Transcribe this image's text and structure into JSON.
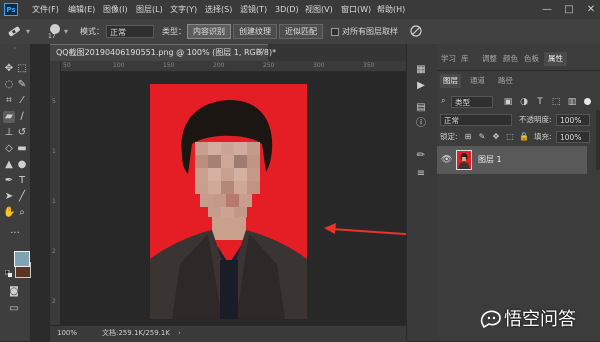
{
  "app": {
    "logo": "Ps"
  },
  "menu": [
    "文件(F)",
    "编辑(E)",
    "图像(I)",
    "图层(L)",
    "文字(Y)",
    "选择(S)",
    "滤镜(T)",
    "3D(D)",
    "视图(V)",
    "窗口(W)",
    "帮助(H)"
  ],
  "window_controls": {
    "minimize": "—",
    "maximize": "□",
    "close": "✕"
  },
  "options": {
    "brush_size": "17",
    "mode_label": "模式：",
    "mode_value": "正常",
    "type_label": "类型：",
    "type_buttons": [
      "内容识别",
      "创建纹理",
      "近似匹配"
    ],
    "sample_all_label": "对所有图层取样"
  },
  "document": {
    "tab_title": "QQ截图20190406190551.png @ 100% (图层 1, RGB/8)",
    "tab_modified": "*",
    "zoom": "100%",
    "file_info": "文档:259.1K/259.1K"
  },
  "rulers": {
    "top": [
      "50",
      "100",
      "150",
      "200",
      "250",
      "300",
      "350"
    ],
    "left": [
      "5",
      "1",
      "1",
      "2",
      "2"
    ]
  },
  "right_tabs_top": [
    "学习",
    "库",
    "调整",
    "颜色",
    "色板",
    "属性"
  ],
  "right_tabs_layers": [
    "图层",
    "通道",
    "路径"
  ],
  "layers_panel": {
    "filter_label": "类型",
    "blend_mode": "正常",
    "opacity_label": "不透明度:",
    "opacity_value": "100%",
    "lock_label": "锁定:",
    "fill_label": "填充:",
    "fill_value": "100%",
    "layers": [
      {
        "name": "图层 1"
      }
    ]
  },
  "watermark": {
    "text": "悟空问答"
  },
  "colors": {
    "foreground": "#7fa3b3",
    "background": "#5a3424",
    "photo_background": "#e41e24",
    "arrow": "#e8342b"
  }
}
